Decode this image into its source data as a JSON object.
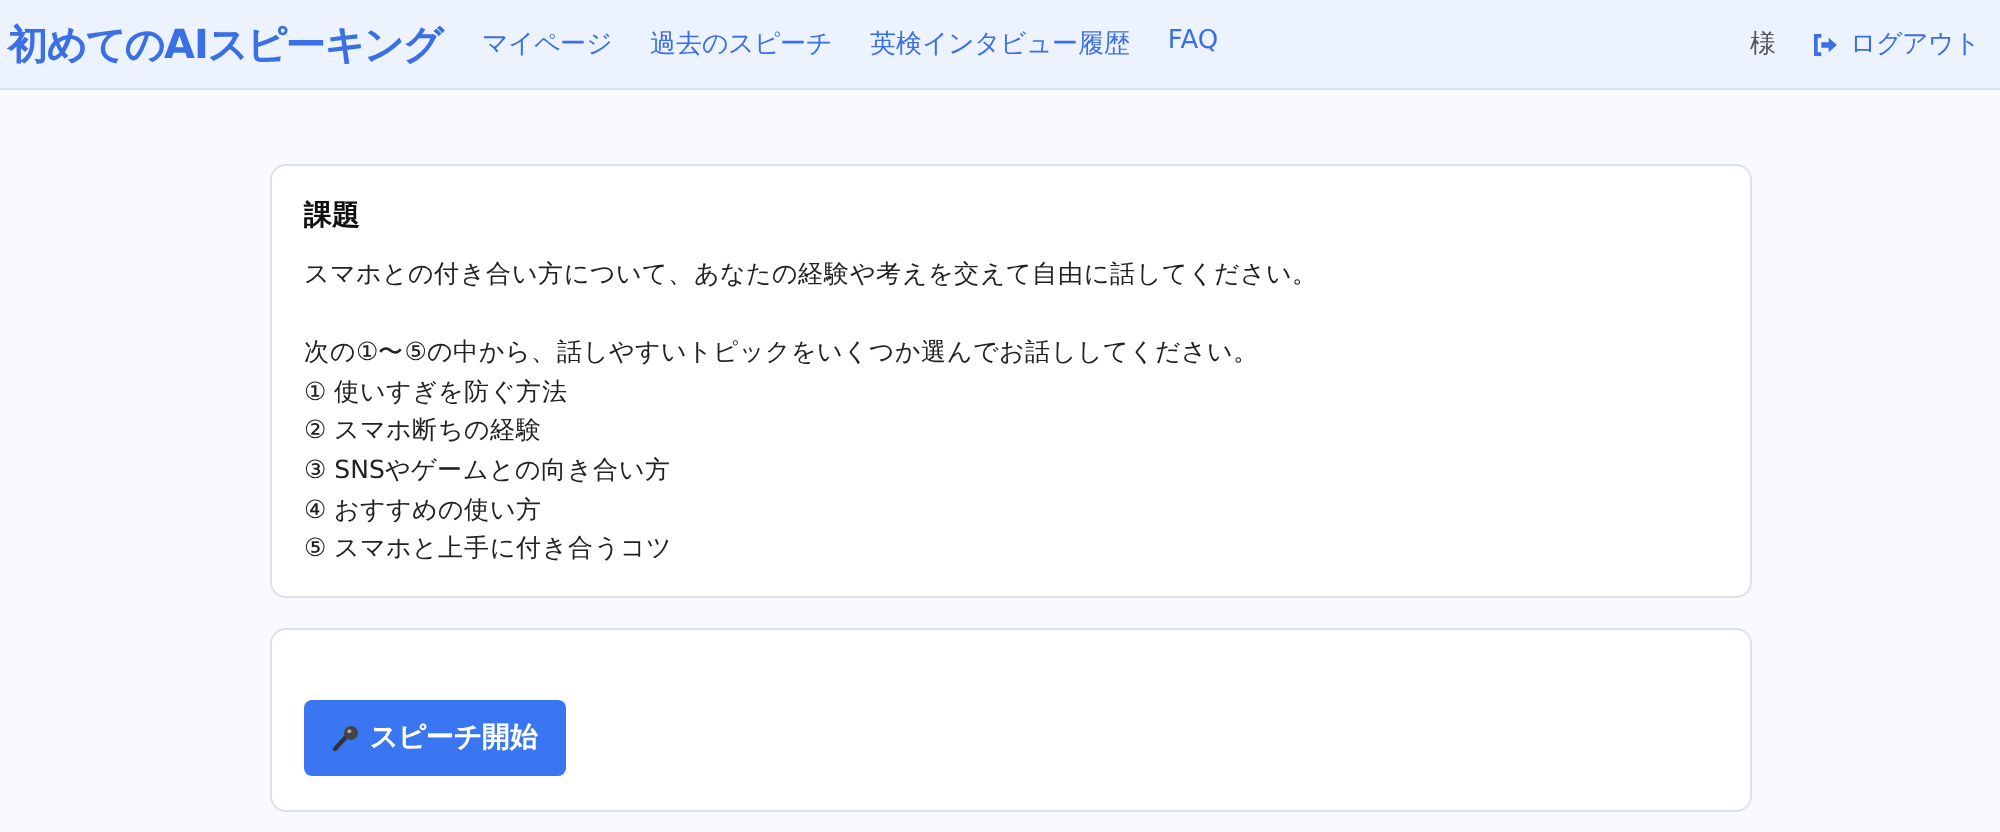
{
  "header": {
    "logo": "初めてのAIスピーキング",
    "nav": [
      "マイページ",
      "過去のスピーチ",
      "英検インタビュー履歴",
      "FAQ"
    ],
    "user": "様",
    "logout": "ログアウト"
  },
  "task": {
    "heading": "課題",
    "prompt": "スマホとの付き合い方について、あなたの経験や考えを交えて自由に話してください。",
    "instruction": "次の①〜⑤の中から、話しやすいトピックをいくつか選んでお話ししてください。",
    "options": [
      "① 使いすぎを防ぐ方法",
      "② スマホ断ちの経験",
      "③ SNSやゲームとの向き合い方",
      "④ おすすめの使い方",
      "⑤ スマホと上手に付き合うコツ"
    ]
  },
  "speech": {
    "button": "スピーチ開始"
  }
}
